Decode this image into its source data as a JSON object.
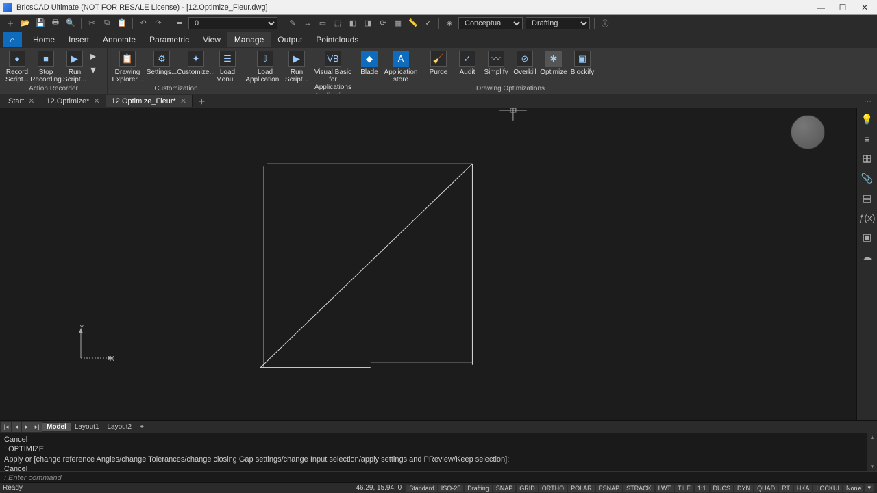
{
  "title": "BricsCAD Ultimate (NOT FOR RESALE License) - [12.Optimize_Fleur.dwg]",
  "qat": {
    "layer_combo": "0",
    "visual_style": "Conceptual",
    "workspace": "Drafting"
  },
  "ribbon": {
    "tabs": [
      "Home",
      "Insert",
      "Annotate",
      "Parametric",
      "View",
      "Manage",
      "Output",
      "Pointclouds"
    ],
    "active_tab": "Manage",
    "groups": {
      "action_recorder": {
        "label": "Action Recorder",
        "tools": [
          "Record Script...",
          "Stop Recording",
          "Run Script..."
        ],
        "extra": [
          "",
          ""
        ]
      },
      "customization": {
        "label": "Customization",
        "tools": [
          "Drawing Explorer...",
          "Settings...",
          "Customize...",
          "Load Menu..."
        ]
      },
      "applications": {
        "label": "Applications",
        "tools": [
          "Load Application...",
          "Run Script...",
          "Visual Basic for Applications",
          "Blade",
          "Application store"
        ]
      },
      "drawing_opts": {
        "label": "Drawing Optimizations",
        "tools": [
          "Purge",
          "Audit",
          "Simplify",
          "Overkill",
          "Optimize",
          "Blockify"
        ]
      }
    }
  },
  "doc_tabs": {
    "items": [
      "Start",
      "12.Optimize*",
      "12.Optimize_Fleur*"
    ],
    "active": 2
  },
  "layout_tabs": {
    "items": [
      "Model",
      "Layout1",
      "Layout2"
    ],
    "active": 0
  },
  "command_history": [
    "Cancel",
    ": OPTIMIZE",
    "Apply or [change reference Angles/change Tolerances/change closing Gap settings/change Input selection/apply settings and PReview/Keep selection]:",
    "Cancel"
  ],
  "command_prompt": ": Enter command",
  "status": {
    "ready": "Ready",
    "coords": "46.29, 15.94, 0",
    "std": "Standard",
    "iso": "ISO-25",
    "ws": "Drafting",
    "toggles": [
      "SNAP",
      "GRID",
      "ORTHO",
      "POLAR",
      "ESNAP",
      "STRACK",
      "LWT",
      "TILE",
      "1:1",
      "DUCS",
      "DYN",
      "QUAD",
      "RT",
      "HKA",
      "LOCKUI",
      "None"
    ]
  },
  "right_tools": [
    "💡",
    "≡",
    "▦",
    "📎",
    "▤",
    "ƒ(x)",
    "▣",
    "☁"
  ]
}
